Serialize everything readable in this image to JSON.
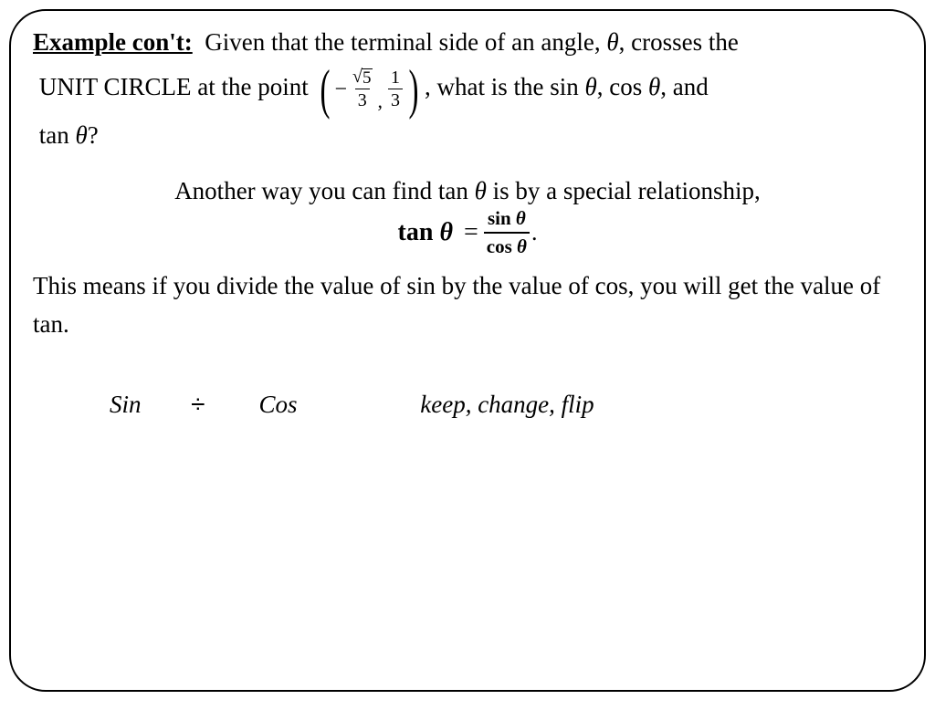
{
  "heading": "Example con't:",
  "prob_a": "Given that the terminal side of an angle, ",
  "theta": "θ",
  "prob_b": ", crosses the",
  "prob_c": "UNIT CIRCLE at the point ",
  "point": {
    "minus": "−",
    "sqrt_arg": "5",
    "den1": "3",
    "num2": "1",
    "den2": "3"
  },
  "prob_d": ", what is the sin ",
  "prob_e": ", cos ",
  "prob_f": ", and",
  "prob_g": "tan ",
  "prob_h": "?",
  "mid": {
    "a": "Another way you can find tan ",
    "b": " is by a special relationship,"
  },
  "formula": {
    "lhs_a": "tan ",
    "eq": "=",
    "num_a": "sin ",
    "den_a": "cos ",
    "period": "."
  },
  "explain": "This means if you divide the value of sin by the value of cos, you will get the value of tan.",
  "bottom": {
    "sin": "Sin",
    "div": "÷",
    "cos": "Cos",
    "kcf": "keep, change, flip"
  }
}
